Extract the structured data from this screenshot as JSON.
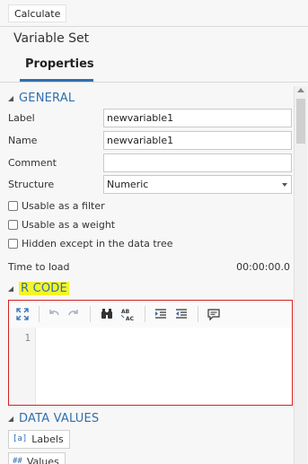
{
  "header": {
    "calculate_label": "Calculate",
    "panel_title": "Variable Set",
    "tab_label": "Properties"
  },
  "general": {
    "heading": "GENERAL",
    "fields": {
      "label": {
        "label": "Label",
        "value": "newvariable1"
      },
      "name": {
        "label": "Name",
        "value": "newvariable1"
      },
      "comment": {
        "label": "Comment",
        "value": ""
      },
      "structure": {
        "label": "Structure",
        "value": "Numeric"
      }
    },
    "checkboxes": [
      {
        "label": "Usable as a filter",
        "checked": false
      },
      {
        "label": "Usable as a weight",
        "checked": false
      },
      {
        "label": "Hidden except in the data tree",
        "checked": false
      }
    ],
    "time_to_load": {
      "label": "Time to load",
      "value": "00:00:00.0"
    }
  },
  "r_code": {
    "heading": "R CODE",
    "line_numbers": [
      "1"
    ],
    "toolbar_icons": [
      "expand-icon",
      "undo-icon",
      "redo-icon",
      "find-icon",
      "replace-icon",
      "indent-icon",
      "outdent-icon",
      "comment-icon"
    ]
  },
  "data_values": {
    "heading": "DATA VALUES",
    "buttons": [
      {
        "label": "Labels",
        "icon": "labels-icon",
        "glyph": "[a]"
      },
      {
        "label": "Values",
        "icon": "values-icon",
        "glyph": "##"
      }
    ]
  },
  "colors": {
    "accent": "#2f6fb0",
    "highlight": "#f4f42a",
    "editor_border": "#d22222"
  }
}
